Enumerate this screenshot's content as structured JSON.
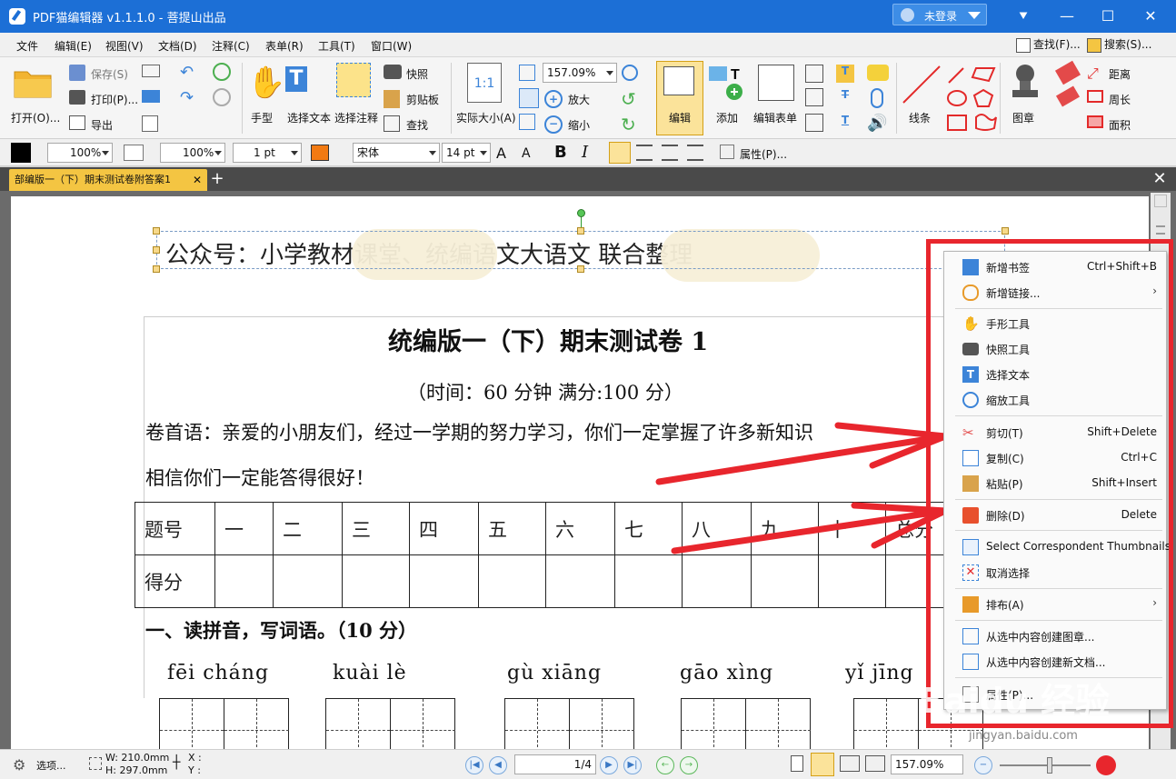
{
  "window": {
    "title": "PDF猫编辑器 v1.1.1.0 - 菩提山出品",
    "login": "未登录"
  },
  "menu": {
    "items": [
      "文件",
      "编辑(E)",
      "视图(V)",
      "文档(D)",
      "注释(C)",
      "表单(R)",
      "工具(T)",
      "窗口(W)"
    ],
    "find": "查找(F)...",
    "search": "搜索(S)..."
  },
  "ribbon": {
    "open": "打开(O)...",
    "save": "保存(S)",
    "print": "打印(P)...",
    "export": "导出",
    "hand": "手型",
    "select_text": "选择文本",
    "select_annot": "选择注释",
    "snapshot": "快照",
    "clipboard": "剪贴板",
    "find": "查找",
    "actual_size": "实际大小(A)",
    "zoom_value": "157.09%",
    "zoom_in": "放大",
    "zoom_out": "缩小",
    "edit": "编辑",
    "add": "添加",
    "edit_form": "编辑表单",
    "lines": "线条",
    "stamp": "图章",
    "distance": "距离",
    "perimeter": "周长",
    "area": "面积"
  },
  "format": {
    "opacity1": "100%",
    "opacity2": "100%",
    "line_width": "1 pt",
    "font": "宋体",
    "font_size": "14 pt",
    "bold": "B",
    "italic": "I",
    "properties": "属性(P)..."
  },
  "tab": {
    "label": "部编版一（下）期末测试卷附答案1"
  },
  "document": {
    "header_text": "公众号：小学教材课堂、统编语文大语文 联合整理",
    "exam_title": "统编版一（下）期末测试卷 1",
    "time_line": "（时间：60 分钟        满分:100 分）",
    "intro1": "卷首语：亲爱的小朋友们，经过一学期的努力学习，你们一定掌握了许多新知识",
    "intro2": "相信你们一定能答得很好！",
    "table_headers": [
      "题号",
      "一",
      "二",
      "三",
      "四",
      "五",
      "六",
      "七",
      "八",
      "九",
      "十",
      "总分"
    ],
    "table_row2_label": "得分",
    "section1": "一、读拼音，写词语。（10 分）",
    "pinyin": [
      "fēi cháng",
      "kuài lè",
      "gù xiāng",
      "gāo xìng",
      "yǐ jīng"
    ]
  },
  "context_menu": {
    "items": [
      {
        "label": "新增书签",
        "shortcut": "Ctrl+Shift+B"
      },
      {
        "label": "新增链接...",
        "submenu": "›"
      },
      {
        "label": "手形工具"
      },
      {
        "label": "快照工具"
      },
      {
        "label": "选择文本"
      },
      {
        "label": "缩放工具"
      },
      {
        "label": "剪切(T)",
        "shortcut": "Shift+Delete"
      },
      {
        "label": "复制(C)",
        "shortcut": "Ctrl+C"
      },
      {
        "label": "粘贴(P)",
        "shortcut": "Shift+Insert"
      },
      {
        "label": "删除(D)",
        "shortcut": "Delete"
      },
      {
        "label": "Select Correspondent Thumbnails"
      },
      {
        "label": "取消选择"
      },
      {
        "label": "排布(A)",
        "submenu": "›"
      },
      {
        "label": "从选中内容创建图章..."
      },
      {
        "label": "从选中内容创建新文档..."
      },
      {
        "label": "属性(P)..."
      }
    ]
  },
  "statusbar": {
    "options": "选项...",
    "width": "W: 210.0mm",
    "height": "H: 297.0mm",
    "x": "X :",
    "y": "Y :",
    "page": "1/4",
    "zoom": "157.09%"
  },
  "watermark": {
    "brand": "Baidu 经验",
    "url": "jingyan.baidu.com"
  },
  "colors": {
    "titlebar": "#1c6fd6",
    "tab_active": "#f4c542",
    "highlight_frame": "#e8262d"
  }
}
